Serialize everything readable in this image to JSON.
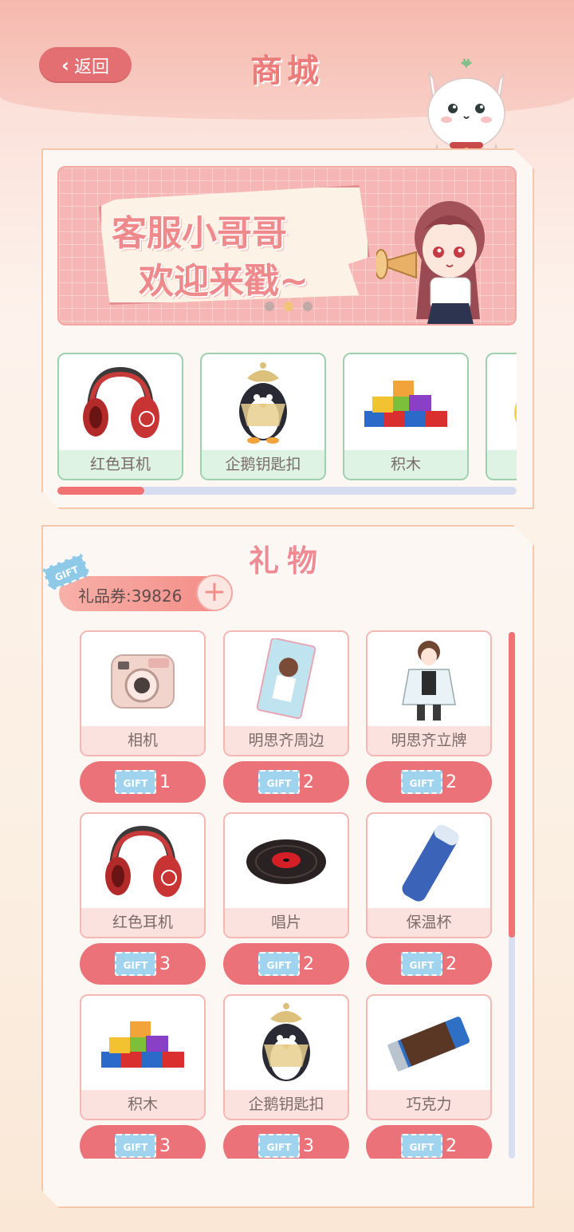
{
  "header": {
    "back_label": "返回",
    "title": "商城"
  },
  "banner": {
    "line1": "客服小哥哥",
    "line2": "欢迎来戳~",
    "slides": 3,
    "active_slide": 2
  },
  "featured": {
    "items": [
      {
        "label": "红色耳机",
        "icon": "headphones-icon"
      },
      {
        "label": "企鹅钥匙扣",
        "icon": "penguin-keychain-icon"
      },
      {
        "label": "积木",
        "icon": "building-blocks-icon"
      },
      {
        "label": "",
        "icon": "plant-icon"
      }
    ],
    "scroll_progress": 0.19
  },
  "gifts": {
    "title": "礼物",
    "ticket_label": "礼品券:39826",
    "ticket_badge": "GIFT",
    "items": [
      {
        "label": "相机",
        "price": "1",
        "icon": "camera-icon"
      },
      {
        "label": "明思齐周边",
        "price": "2",
        "icon": "photo-card-icon"
      },
      {
        "label": "明思齐立牌",
        "price": "2",
        "icon": "standee-icon"
      },
      {
        "label": "红色耳机",
        "price": "3",
        "icon": "headphones-icon"
      },
      {
        "label": "唱片",
        "price": "2",
        "icon": "vinyl-record-icon"
      },
      {
        "label": "保温杯",
        "price": "2",
        "icon": "thermos-icon"
      },
      {
        "label": "积木",
        "price": "3",
        "icon": "building-blocks-icon"
      },
      {
        "label": "企鹅钥匙扣",
        "price": "3",
        "icon": "penguin-keychain-icon"
      },
      {
        "label": "巧克力",
        "price": "2",
        "icon": "chocolate-icon"
      }
    ],
    "scroll_progress": 0.58
  },
  "colors": {
    "accent": "#ea7278",
    "featured_border": "#9fd0ae",
    "ticket_blue": "#9fd3ee"
  }
}
